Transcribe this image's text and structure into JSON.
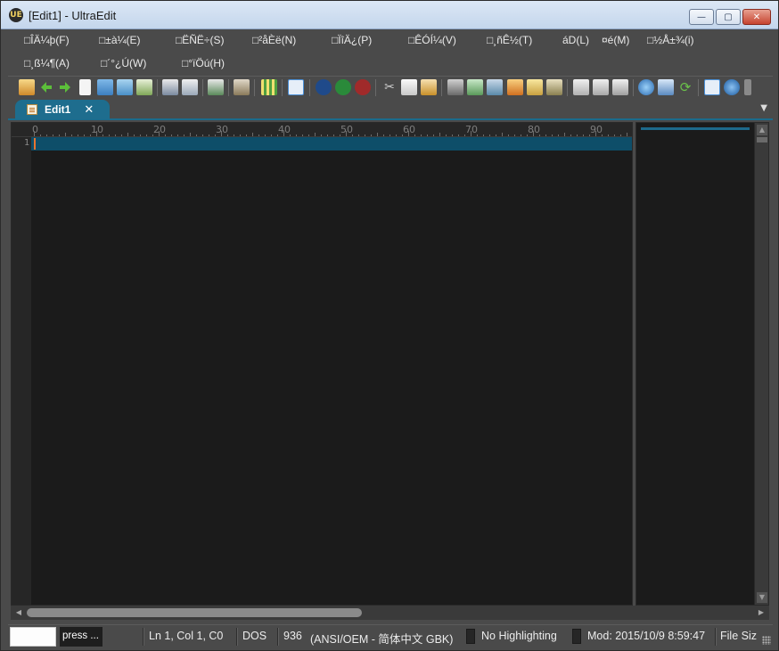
{
  "window": {
    "title": "[Edit1] - UltraEdit",
    "app_icon": "ultraedit-logo-icon",
    "app_icon_text": "UE",
    "controls": {
      "minimize": "—",
      "maximize": "▢",
      "close": "✕"
    }
  },
  "menubar": {
    "row1": [
      "□ÎÄ¼þ(F)",
      "□±à¼­(E)",
      "□ËÑË÷(S)",
      "□²åÈë(N)",
      "□ÏîÄ¿(P)",
      "□ÊÓÍ¼(V)",
      "□¸ñÊ½(T)",
      "áD(L)",
      "¤é(M)",
      "□½Å±¾(i)"
    ],
    "row2": [
      "□¸ß¼¶(A)",
      "□´°¿Ú(W)",
      "□°ïÖú(H)"
    ]
  },
  "toolbar": {
    "buttons": [
      "project-icon",
      "back-arrow-icon",
      "forward-arrow-icon",
      "new-file-icon",
      "open-folder-icon",
      "open-folder-alt-icon",
      "save-icon",
      "print-icon",
      "print-preview-icon",
      "word-wrap-icon",
      "column-mode-icon",
      "hex-mode-icon",
      "line-numbers-icon",
      "uc-icon",
      "uf-icon",
      "us-icon",
      "cut-icon",
      "copy-icon",
      "paste-icon",
      "find-icon",
      "replace-icon",
      "replace-files-icon",
      "bookmark-icon",
      "list-icon",
      "macro-icon",
      "split-icon",
      "tile-icon",
      "cascade-icon",
      "web-icon",
      "browser-preview-icon",
      "refresh-icon",
      "output-window-icon",
      "help-icon",
      "overflow-chevron-icon"
    ]
  },
  "tabs": [
    {
      "label": "Edit1",
      "icon": "file-icon",
      "close": "✕",
      "active": true
    }
  ],
  "tab_dropdown": "▼",
  "editor": {
    "ruler_numbers": [
      "0",
      "10",
      "20",
      "30",
      "40",
      "50",
      "60",
      "70",
      "80",
      "90"
    ],
    "line_numbers": [
      "1"
    ],
    "content": ""
  },
  "scrollbars": {
    "up": "▲",
    "down": "▼",
    "left": "◀",
    "right": "▶"
  },
  "statusbar": {
    "press_label": "press ...",
    "position": "Ln 1, Col 1, C0",
    "line_ending": "DOS",
    "codepage": "936",
    "encoding": "(ANSI/OEM - 简体中文 GBK)",
    "highlighting": "No Highlighting",
    "modified": "Mod: 2015/10/9 8:59:47",
    "file_size": "File Siz"
  }
}
